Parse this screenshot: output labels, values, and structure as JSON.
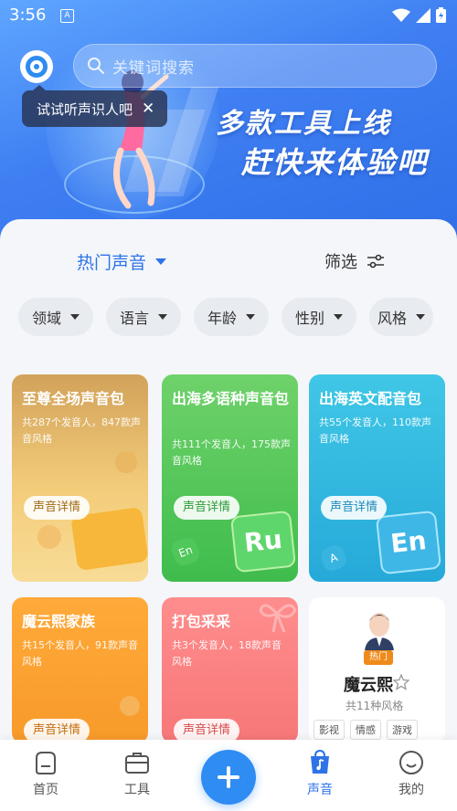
{
  "status_bar": {
    "time": "3:56",
    "notif_letter": "A"
  },
  "search": {
    "placeholder": "关键词搜索"
  },
  "tooltip": {
    "text": "试试听声识人吧",
    "close": "✕"
  },
  "banner": {
    "line1": "多款工具上线",
    "line2": "赶快来体验吧"
  },
  "sort": {
    "label": "热门声音",
    "filter_label": "筛选"
  },
  "chips": [
    "领域",
    "语言",
    "年龄",
    "性别",
    "风格"
  ],
  "cards": [
    {
      "title": "至尊全场声音包",
      "desc": "共287个发音人，847款声音风格",
      "button": "声音详情"
    },
    {
      "title": "出海多语种声音包",
      "desc": "共111个发音人，175款声音风格",
      "button": "声音详情",
      "badge": "Ru",
      "small": "En"
    },
    {
      "title": "出海英文配音包",
      "desc": "共55个发音人，110款声音风格",
      "button": "声音详情",
      "badge": "En",
      "small": "A"
    },
    {
      "title": "魔云熙家族",
      "desc": "共15个发音人，91款声音风格",
      "button": "声音详情"
    },
    {
      "title": "打包采采",
      "desc": "共3个发音人，18款声音风格",
      "button": "声音详情"
    }
  ],
  "voice_card": {
    "hot": "热门",
    "name": "魔云熙",
    "count": "共11种风格",
    "tags": [
      "影视",
      "情感",
      "游戏"
    ]
  },
  "bottom_nav": [
    {
      "label": "首页",
      "active": false
    },
    {
      "label": "工具",
      "active": false
    },
    {
      "label": "声音",
      "active": true
    },
    {
      "label": "我的",
      "active": false
    }
  ],
  "colors": {
    "accent": "#2f8cf3",
    "active": "#2e73e8",
    "inactive": "#555555"
  }
}
